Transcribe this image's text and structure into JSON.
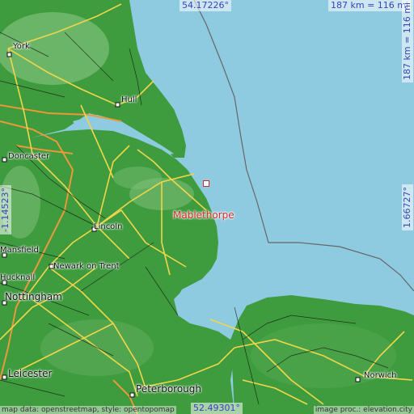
{
  "coords": {
    "top": "54.17226°",
    "bottom": "52.49301°",
    "left": "-1.14523°",
    "right": "1.66727°"
  },
  "scale": {
    "horizontal": "187 km = 116 mi",
    "vertical": "187 km = 116 mi"
  },
  "highlight": {
    "name": "Mablethorpe",
    "color": "#d62828"
  },
  "cities": [
    {
      "name": "York"
    },
    {
      "name": "Hull"
    },
    {
      "name": "Doncaster"
    },
    {
      "name": "Lincoln"
    },
    {
      "name": "Mansfield"
    },
    {
      "name": "Newark on Trent"
    },
    {
      "name": "Hucknall"
    },
    {
      "name": "Nottingham"
    },
    {
      "name": "Leicester"
    },
    {
      "name": "Peterborough"
    },
    {
      "name": "Norwich"
    }
  ],
  "attribution": {
    "left": "map data: openstreetmap, style: opentopomap",
    "right": "image proc.: elevation.city"
  },
  "colors": {
    "sea": "#8fcbe0",
    "land": "#3e9b3e",
    "highland": "#7fc07a",
    "roads_major": "#f1d64b",
    "roads_minor": "#111111",
    "motorway": "#e89a3a"
  }
}
